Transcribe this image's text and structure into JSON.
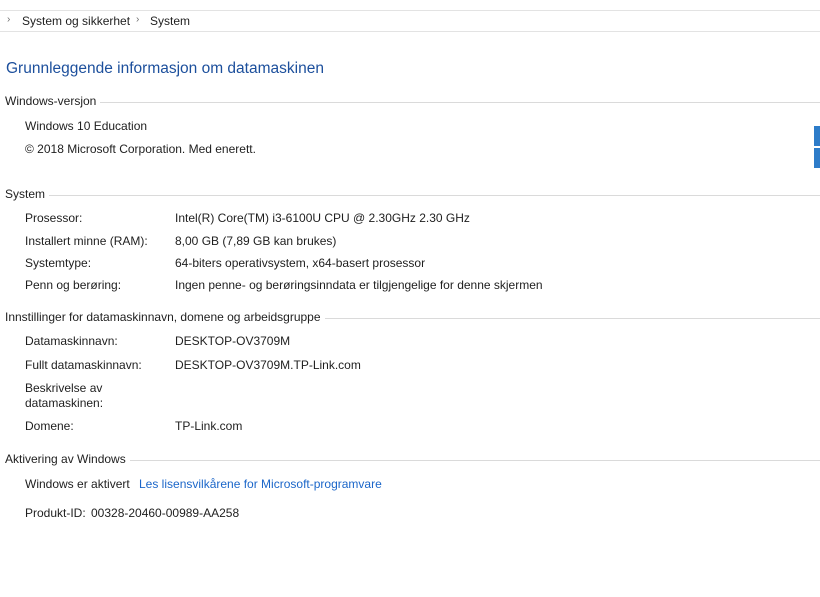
{
  "breadcrumb": {
    "items": [
      "System og sikkerhet",
      "System"
    ]
  },
  "page_title": "Grunnleggende informasjon om datamaskinen",
  "windows_version": {
    "header": "Windows-versjon",
    "edition": "Windows 10 Education",
    "copyright": "© 2018 Microsoft Corporation. Med enerett."
  },
  "system": {
    "header": "System",
    "rows": [
      {
        "label": "Prosessor:",
        "value": "Intel(R) Core(TM) i3-6100U CPU @ 2.30GHz   2.30 GHz"
      },
      {
        "label": "Installert minne (RAM):",
        "value": "8,00 GB (7,89 GB kan brukes)"
      },
      {
        "label": "Systemtype:",
        "value": "64-biters operativsystem, x64-basert prosessor"
      },
      {
        "label": "Penn og berøring:",
        "value": "Ingen penne- og berøringsinndata er tilgjengelige for denne skjermen"
      }
    ]
  },
  "computer_name": {
    "header": "Innstillinger for datamaskinnavn, domene og arbeidsgruppe",
    "rows": [
      {
        "label": "Datamaskinnavn:",
        "value": "DESKTOP-OV3709M"
      },
      {
        "label": "Fullt datamaskinnavn:",
        "value": "DESKTOP-OV3709M.TP-Link.com"
      },
      {
        "label": "Beskrivelse av datamaskinen:",
        "value": ""
      },
      {
        "label": "Domene:",
        "value": "TP-Link.com"
      }
    ]
  },
  "activation": {
    "header": "Aktivering av Windows",
    "status": "Windows er aktivert",
    "license_link": "Les lisensvilkårene for Microsoft-programvare",
    "product_id_label": "Produkt-ID:",
    "product_id": "00328-20460-00989-AA258"
  },
  "colors": {
    "title": "#1c4f9c",
    "link": "#1b66c9",
    "edge_accent": "#2d7cc9"
  }
}
